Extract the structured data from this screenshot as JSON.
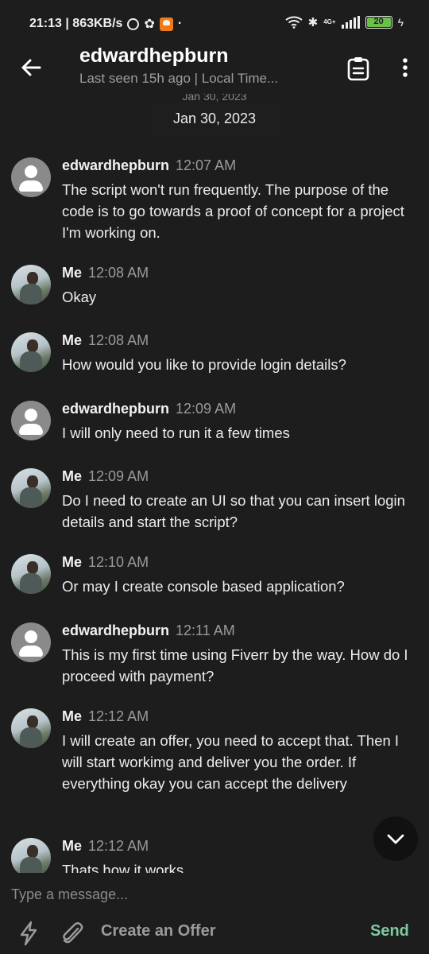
{
  "status_bar": {
    "time_speed": "21:13 | 863KB/s",
    "net_type": "4G+",
    "battery": "20",
    "icons": [
      "alarm-icon",
      "settings-icon",
      "app-notification-icon",
      "wifi-icon",
      "bluetooth-icon",
      "signal-icon",
      "battery-icon",
      "charging-icon"
    ]
  },
  "header": {
    "contact_name": "edwardhepburn",
    "last_seen": "Last seen 15h ago | Local Time...",
    "icons": [
      "back-arrow-icon",
      "clipboard-icon",
      "more-vertical-icon"
    ]
  },
  "date_divider": {
    "ghost": "Jan 30, 2023",
    "label": "Jan 30, 2023"
  },
  "messages": [
    {
      "sender": "edwardhepburn",
      "time": "12:07 AM",
      "avatar": "default",
      "text": "The script won't run frequently. The purpose of the code is to go towards a proof of concept for a project I'm working on."
    },
    {
      "sender": "Me",
      "time": "12:08 AM",
      "avatar": "photo",
      "text": "Okay"
    },
    {
      "sender": "Me",
      "time": "12:08 AM",
      "avatar": "photo",
      "text": "How would you like to provide login details?"
    },
    {
      "sender": "edwardhepburn",
      "time": "12:09 AM",
      "avatar": "default",
      "text": "I will only need to run it a few times"
    },
    {
      "sender": "Me",
      "time": "12:09 AM",
      "avatar": "photo",
      "text": "Do I need to create an UI so that you can insert login details and start the script?"
    },
    {
      "sender": "Me",
      "time": "12:10 AM",
      "avatar": "photo",
      "text": "Or may I create console based application?"
    },
    {
      "sender": "edwardhepburn",
      "time": "12:11 AM",
      "avatar": "default",
      "text": "This is my first time using Fiverr by the way. How do I proceed with payment?"
    },
    {
      "sender": "Me",
      "time": "12:12 AM",
      "avatar": "photo",
      "text": "I will create an offer, you need to accept that. Then I will start workimg and deliver you the order. If everything okay you can accept the delivery"
    },
    {
      "sender": "Me",
      "time": "12:12 AM",
      "avatar": "photo",
      "text": "Thats how it works"
    }
  ],
  "composer": {
    "placeholder": "Type a message...",
    "create_offer_label": "Create an Offer",
    "send_label": "Send",
    "icons": [
      "lightning-icon",
      "paperclip-icon",
      "chevron-down-icon"
    ]
  },
  "colors": {
    "background": "#1d1d1d",
    "text": "#ececec",
    "muted": "#9a9a9a",
    "send_accent": "#7fc9a0",
    "battery_green": "#6cc04a"
  }
}
